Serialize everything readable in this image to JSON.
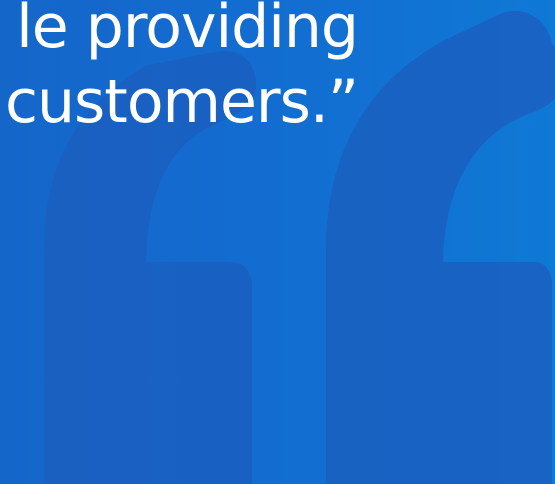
{
  "testimonial": {
    "quote_lines": [
      "le providing",
      "customers.”"
    ]
  },
  "decoration": {
    "icon": "quote-mark-icon",
    "color": "#1a5fc0"
  }
}
